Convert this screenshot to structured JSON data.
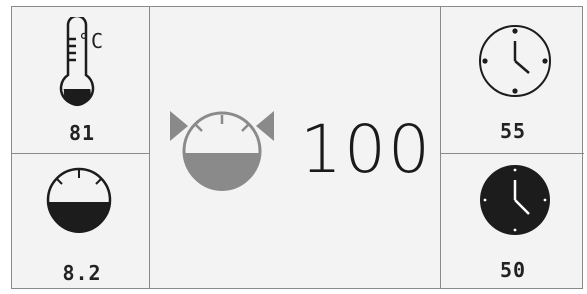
{
  "temperature": {
    "unit": "°C",
    "value": "81",
    "icon": "thermometer-icon"
  },
  "fuel_gauge": {
    "value": "8.2",
    "icon": "fuel-gauge-icon"
  },
  "main_gauge": {
    "value": "100",
    "icon": "gauge-with-arrows-icon",
    "fill_color": "#8a8a8a"
  },
  "clock_light": {
    "value": "55",
    "icon": "clock-outline-icon"
  },
  "clock_dark": {
    "value": "50",
    "icon": "clock-filled-icon"
  },
  "colors": {
    "panel": "#f3f3f3",
    "border": "#8a8a8a",
    "dark": "#1c1c1c",
    "gray": "#8a8a8a"
  }
}
